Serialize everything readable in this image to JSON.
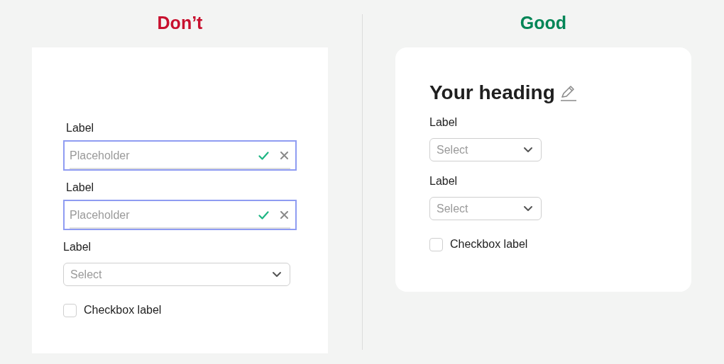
{
  "panels": [
    {
      "title": "Don’t",
      "color": "#c8102e",
      "fields": [
        {
          "kind": "input",
          "label": "Label",
          "placeholder": "Placeholder"
        },
        {
          "kind": "input",
          "label": "Label",
          "placeholder": "Placeholder"
        },
        {
          "kind": "select",
          "label": "Label",
          "placeholder": "Select"
        },
        {
          "kind": "checkbox",
          "label": "Checkbox label",
          "checked": false
        }
      ]
    },
    {
      "title": "Good",
      "color": "#008556",
      "heading": "Your heading",
      "fields": [
        {
          "kind": "select",
          "label": "Label",
          "placeholder": "Select"
        },
        {
          "kind": "select",
          "label": "Label",
          "placeholder": "Select"
        },
        {
          "kind": "checkbox",
          "label": "Checkbox label",
          "checked": false
        }
      ]
    }
  ]
}
